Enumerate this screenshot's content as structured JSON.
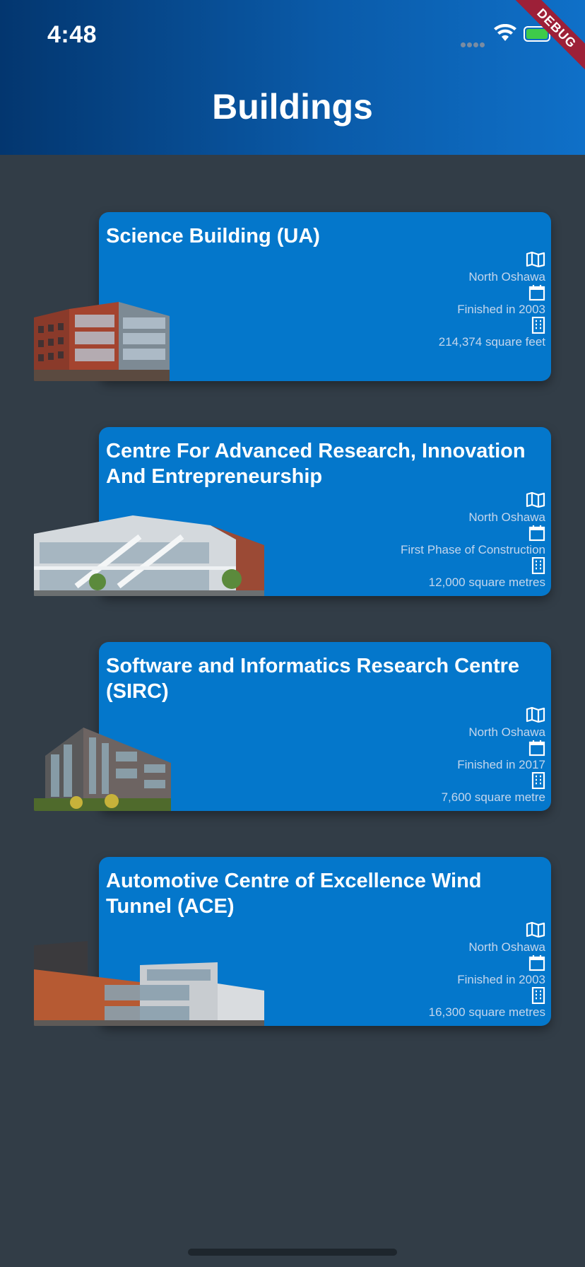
{
  "status_bar": {
    "time": "4:48"
  },
  "debug_banner": "DEBUG",
  "app_bar": {
    "title": "Buildings"
  },
  "colors": {
    "card": "#0477cb",
    "background": "#323d47",
    "appbar_start": "#03366f",
    "appbar_end": "#0f70c8",
    "debug": "#9d2038"
  },
  "buildings": [
    {
      "name": "Science Building (UA)",
      "location": "North Oshawa",
      "status": "Finished in 2003",
      "size": "214,374 square feet",
      "icons": [
        "map-icon",
        "calendar-icon",
        "building-icon"
      ]
    },
    {
      "name": "Centre For Advanced Research, Innovation And Entrepreneurship",
      "location": "North Oshawa",
      "status": "First Phase of Construction",
      "size": "12,000 square metres",
      "icons": [
        "map-icon",
        "calendar-icon",
        "building-icon"
      ]
    },
    {
      "name": "Software and Informatics Research Centre (SIRC)",
      "location": "North Oshawa",
      "status": "Finished in 2017",
      "size": "7,600 square metre",
      "icons": [
        "map-icon",
        "calendar-icon",
        "building-icon"
      ]
    },
    {
      "name": "Automotive Centre of Excellence Wind Tunnel (ACE)",
      "location": "North Oshawa",
      "status": "Finished in 2003",
      "size": "16,300 square metres",
      "icons": [
        "map-icon",
        "calendar-icon",
        "building-icon"
      ]
    }
  ]
}
